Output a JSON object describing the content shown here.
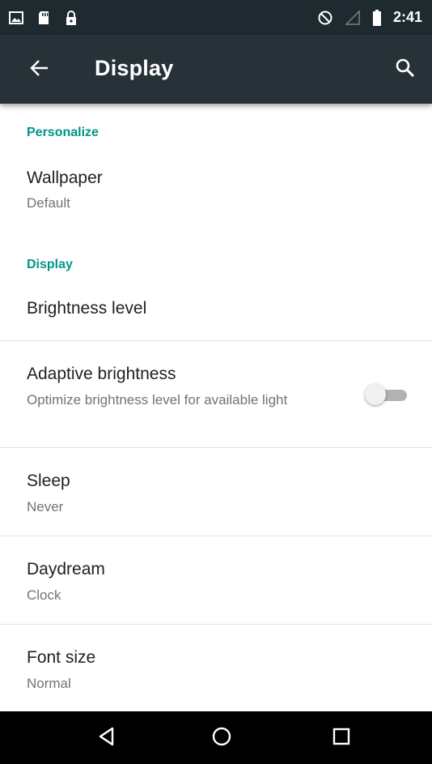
{
  "status_bar": {
    "time": "2:41",
    "icons": [
      "image-icon",
      "sd-card-icon",
      "lock-icon",
      "do-not-disturb-icon",
      "signal-icon",
      "battery-icon"
    ]
  },
  "toolbar": {
    "title": "Display",
    "back_icon": "arrow-back-icon",
    "search_icon": "search-icon"
  },
  "sections": [
    {
      "header": "Personalize",
      "items": [
        {
          "title": "Wallpaper",
          "summary": "Default"
        }
      ]
    },
    {
      "header": "Display",
      "items": [
        {
          "title": "Brightness level",
          "summary": ""
        },
        {
          "title": "Adaptive brightness",
          "summary": "Optimize brightness level for available light",
          "toggle_on": false
        },
        {
          "title": "Sleep",
          "summary": "Never"
        },
        {
          "title": "Daydream",
          "summary": "Clock"
        },
        {
          "title": "Font size",
          "summary": "Normal"
        }
      ]
    }
  ],
  "colors": {
    "status_bar": "#1e2a30",
    "toolbar": "#263238",
    "accent": "#009688",
    "title_text": "#212121",
    "summary_text": "#737373"
  },
  "nav_bar": {
    "icons": [
      "back-triangle-icon",
      "home-circle-icon",
      "recents-square-icon"
    ]
  }
}
